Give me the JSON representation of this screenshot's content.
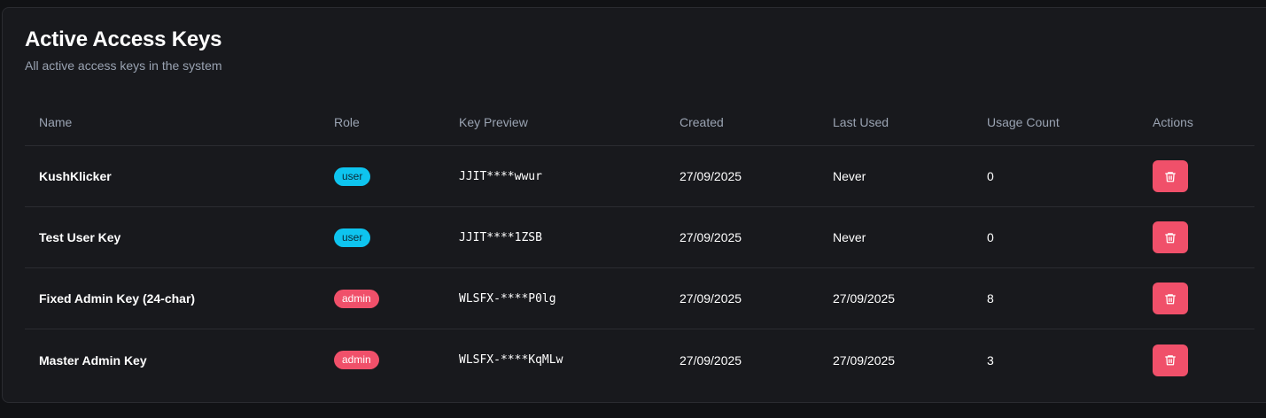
{
  "card": {
    "title": "Active Access Keys",
    "subtitle": "All active access keys in the system"
  },
  "table": {
    "headers": {
      "name": "Name",
      "role": "Role",
      "key_preview": "Key Preview",
      "created": "Created",
      "last_used": "Last Used",
      "usage_count": "Usage Count",
      "actions": "Actions"
    },
    "rows": [
      {
        "name": "KushKlicker",
        "role": "user",
        "key_preview": "JJIT****wwur",
        "created": "27/09/2025",
        "last_used": "Never",
        "usage_count": "0",
        "action_icon": "trash-icon"
      },
      {
        "name": "Test User Key",
        "role": "user",
        "key_preview": "JJIT****1ZSB",
        "created": "27/09/2025",
        "last_used": "Never",
        "usage_count": "0",
        "action_icon": "trash-icon"
      },
      {
        "name": "Fixed Admin Key (24-char)",
        "role": "admin",
        "key_preview": "WLSFX-****P0lg",
        "created": "27/09/2025",
        "last_used": "27/09/2025",
        "usage_count": "8",
        "action_icon": "trash-icon"
      },
      {
        "name": "Master Admin Key",
        "role": "admin",
        "key_preview": "WLSFX-****KqMLw",
        "created": "27/09/2025",
        "last_used": "27/09/2025",
        "usage_count": "3",
        "action_icon": "trash-icon"
      }
    ]
  },
  "colors": {
    "background": "#111215",
    "card": "#18191d",
    "user_badge": "#0ec4ef",
    "admin_badge": "#f0506a",
    "delete_button": "#f0506a",
    "muted_text": "#9aa3b2"
  }
}
